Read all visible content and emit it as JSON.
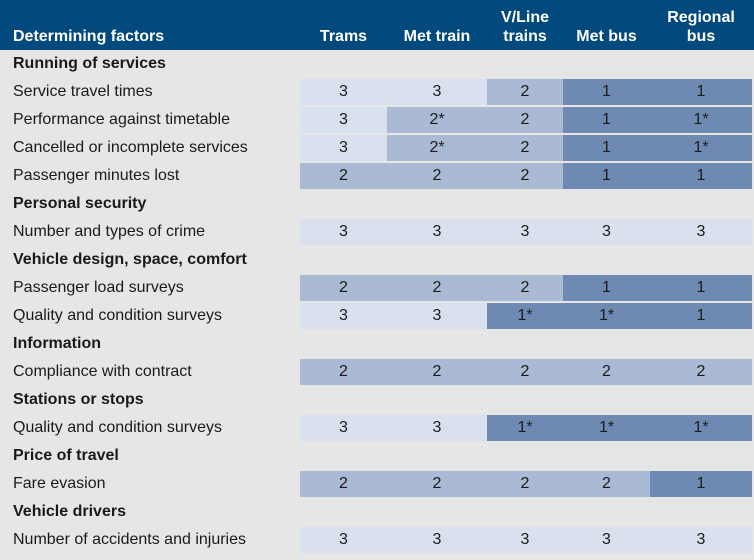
{
  "header": {
    "label": "Determining factors",
    "columns": [
      "Trams",
      "Met train",
      "V/Line trains",
      "Met bus",
      "Regional bus"
    ]
  },
  "colors": {
    "header": "#024a7d",
    "level3": "#dae1ee",
    "level2": "#aab9d4",
    "level1": "#6f8ab2"
  },
  "sections": [
    {
      "title": "Running of services",
      "rows": [
        {
          "label": "Service travel times",
          "values": [
            "3",
            "3",
            "2",
            "1",
            "1"
          ]
        },
        {
          "label": "Performance against timetable",
          "values": [
            "3",
            "2*",
            "2",
            "1",
            "1*"
          ]
        },
        {
          "label": "Cancelled or incomplete services",
          "values": [
            "3",
            "2*",
            "2",
            "1",
            "1*"
          ]
        },
        {
          "label": "Passenger minutes lost",
          "values": [
            "2",
            "2",
            "2",
            "1",
            "1"
          ]
        }
      ]
    },
    {
      "title": "Personal security",
      "rows": [
        {
          "label": "Number and types of crime",
          "values": [
            "3",
            "3",
            "3",
            "3",
            "3"
          ]
        }
      ]
    },
    {
      "title": "Vehicle design, space, comfort",
      "rows": [
        {
          "label": "Passenger load surveys",
          "values": [
            "2",
            "2",
            "2",
            "1",
            "1"
          ]
        },
        {
          "label": "Quality and condition surveys",
          "values": [
            "3",
            "3",
            "1*",
            "1*",
            "1"
          ]
        }
      ]
    },
    {
      "title": "Information",
      "rows": [
        {
          "label": "Compliance with contract",
          "values": [
            "2",
            "2",
            "2",
            "2",
            "2"
          ]
        }
      ]
    },
    {
      "title": "Stations or stops",
      "rows": [
        {
          "label": "Quality and condition surveys",
          "values": [
            "3",
            "3",
            "1*",
            "1*",
            "1*"
          ]
        }
      ]
    },
    {
      "title": "Price of travel",
      "rows": [
        {
          "label": "Fare evasion",
          "values": [
            "2",
            "2",
            "2",
            "2",
            "1"
          ]
        }
      ]
    },
    {
      "title": "Vehicle drivers",
      "rows": [
        {
          "label": "Number of accidents and injuries",
          "values": [
            "3",
            "3",
            "3",
            "3",
            "3"
          ]
        }
      ]
    }
  ]
}
